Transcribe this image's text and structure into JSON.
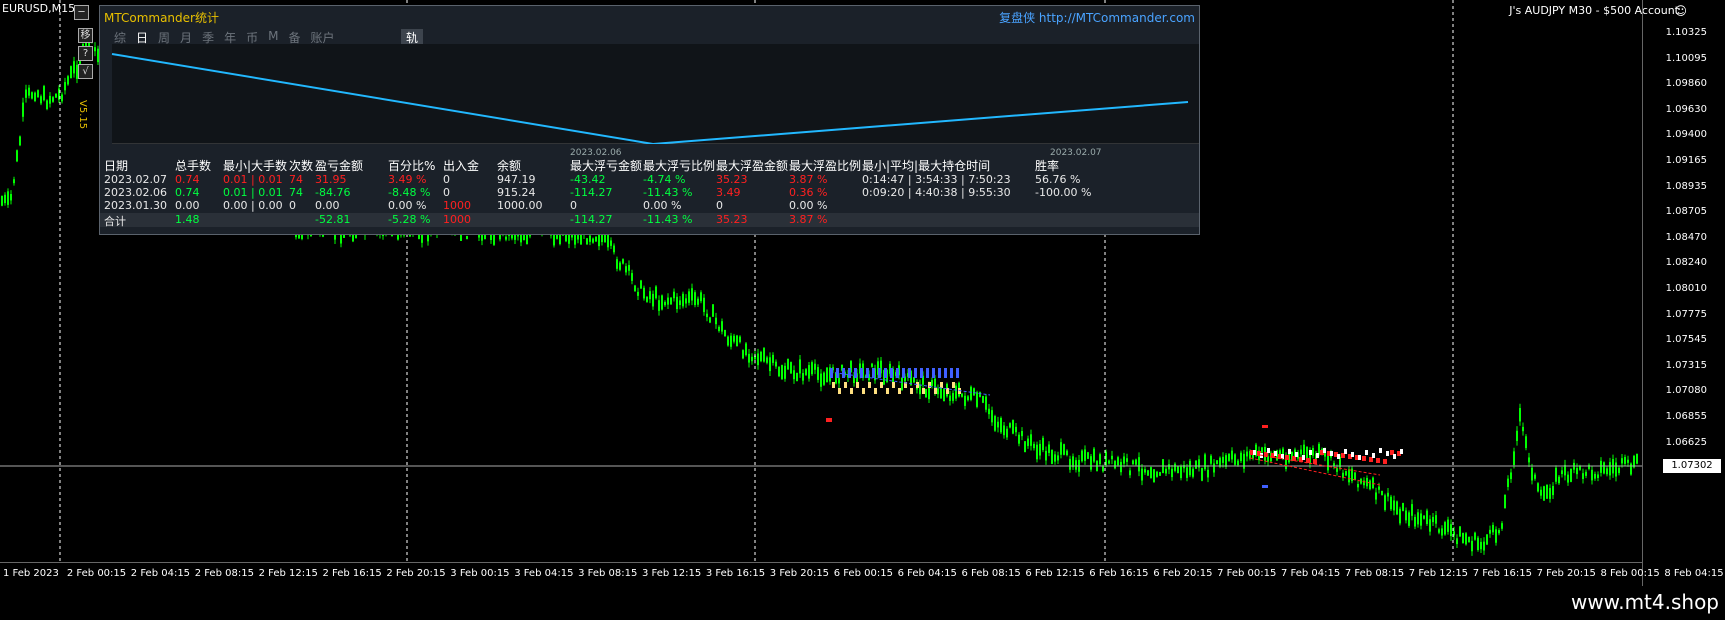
{
  "chart": {
    "symbol_title": "EURUSD,M15",
    "account_title": "J's AUDJPY M30 - $500 Account",
    "current_price": "1.07302",
    "price_levels": [
      "1.10325",
      "1.10095",
      "1.09860",
      "1.09630",
      "1.09400",
      "1.09165",
      "1.08935",
      "1.08705",
      "1.08470",
      "1.08240",
      "1.08010",
      "1.07775",
      "1.07545",
      "1.07315",
      "1.07080",
      "1.06855",
      "1.06625"
    ],
    "time_labels": [
      "1 Feb 2023",
      "2 Feb 00:15",
      "2 Feb 04:15",
      "2 Feb 08:15",
      "2 Feb 12:15",
      "2 Feb 16:15",
      "2 Feb 20:15",
      "3 Feb 00:15",
      "3 Feb 04:15",
      "3 Feb 08:15",
      "3 Feb 12:15",
      "3 Feb 16:15",
      "3 Feb 20:15",
      "6 Feb 00:15",
      "6 Feb 04:15",
      "6 Feb 08:15",
      "6 Feb 12:15",
      "6 Feb 16:15",
      "6 Feb 20:15",
      "7 Feb 00:15",
      "7 Feb 04:15",
      "7 Feb 08:15",
      "7 Feb 12:15",
      "7 Feb 16:15",
      "7 Feb 20:15",
      "8 Feb 00:15",
      "8 Feb 04:15"
    ],
    "colors": {
      "candle": "#00ff00",
      "grid": "#ffffff",
      "axis": "#ffffff"
    }
  },
  "tools": {
    "move_label": "移",
    "help_label": "?",
    "check_label": "√",
    "minimize_label": "─"
  },
  "version": "V5.15",
  "panel": {
    "title": "MTCommander统计",
    "link": "复盘侠 http://MTCommander.com",
    "tabs": [
      "综",
      "日",
      "周",
      "月",
      "季",
      "年",
      "币",
      "M",
      "备",
      "账户"
    ],
    "active_tab": "日",
    "track_tab": "轨迹",
    "equity_start_date": "2023.02.06",
    "equity_end_date": "2023.02.07",
    "headers": [
      "日期",
      "总手数",
      "最小|大手数",
      "次数",
      "盈亏金额",
      "百分比%",
      "出入金",
      "余额",
      "最大浮亏金额",
      "最大浮亏比例",
      "最大浮盈金额",
      "最大浮盈比例",
      "最小|平均|最大持仓时间",
      "胜率"
    ],
    "rows": [
      [
        "2023.02.07",
        "0.74",
        "0.01 | 0.01",
        "74",
        "31.95",
        "3.49 %",
        "0",
        "947.19",
        "-43.42",
        "-4.74 %",
        "35.23",
        "3.87 %",
        "0:14:47 | 3:54:33 | 7:50:23",
        "56.76 %"
      ],
      [
        "2023.02.06",
        "0.74",
        "0.01 | 0.01",
        "74",
        "-84.76",
        "-8.48 %",
        "0",
        "915.24",
        "-114.27",
        "-11.43 %",
        "3.49",
        "0.36 %",
        "0:09:20 | 4:40:38 | 9:55:30",
        "-100.00 %"
      ],
      [
        "2023.01.30",
        "0.00",
        "0.00 | 0.00",
        "0",
        "0.00",
        "0.00 %",
        "1000",
        "1000.00",
        "0",
        "0.00 %",
        "0",
        "0.00 %",
        "",
        ""
      ]
    ],
    "total": [
      "合计",
      "1.48",
      "",
      "",
      "-52.81",
      "-5.28 %",
      "1000",
      "",
      "-114.27",
      "-11.43 %",
      "35.23",
      "3.87 %",
      "",
      ""
    ]
  },
  "watermark": "www.mt4.shop"
}
